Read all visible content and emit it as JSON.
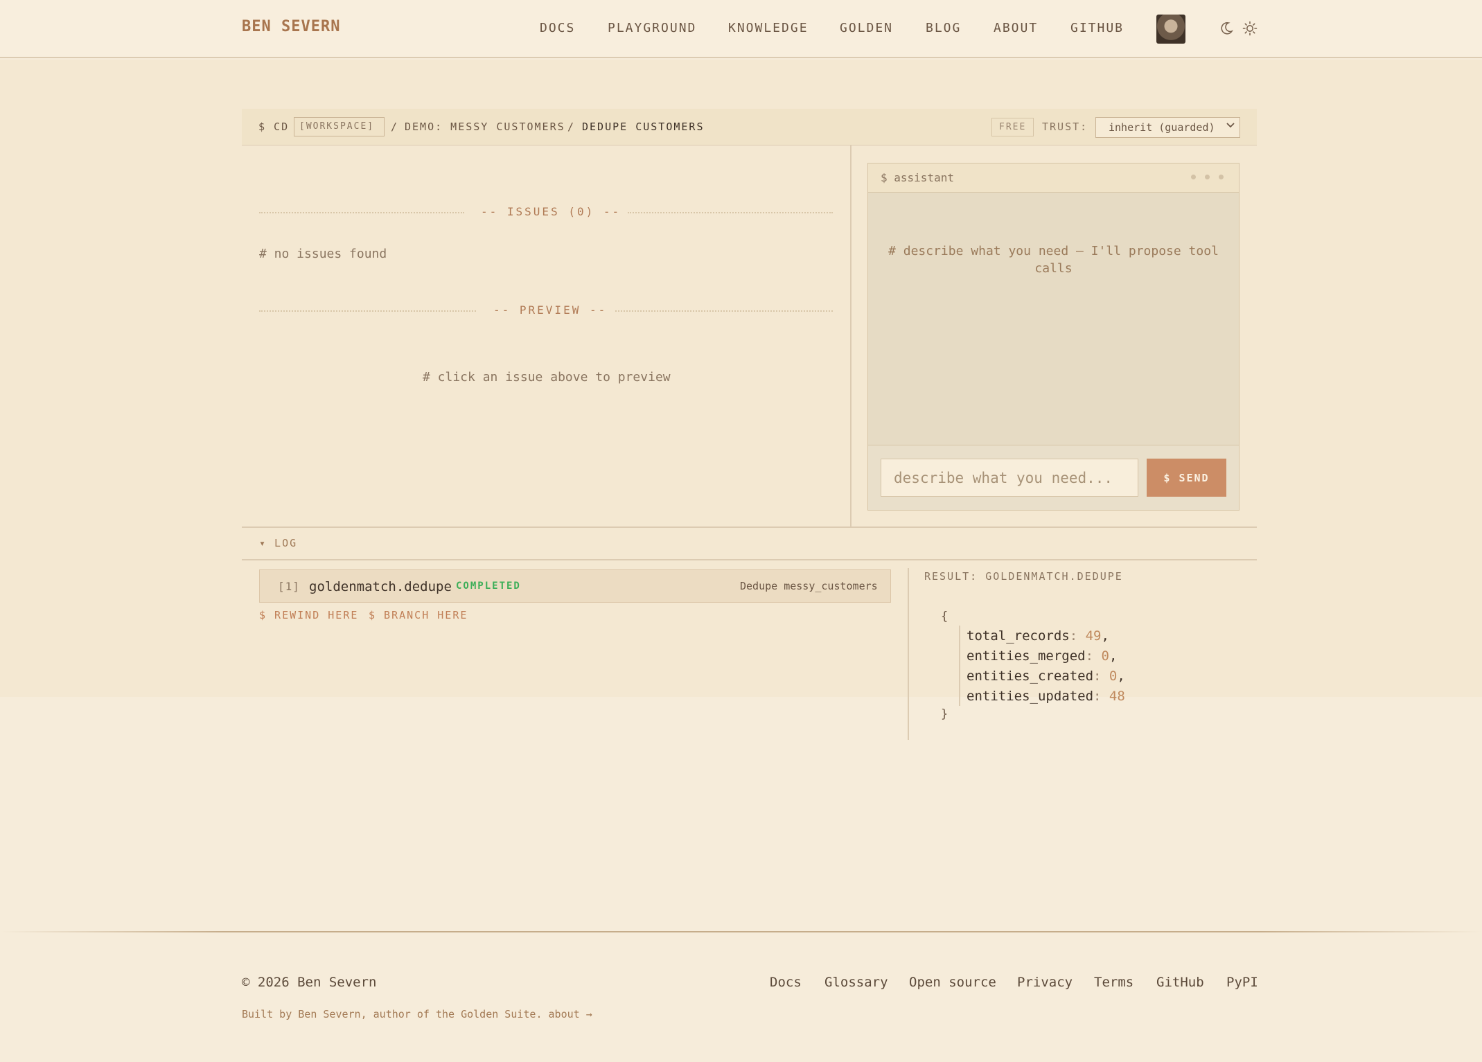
{
  "header": {
    "brand": "BEN SEVERN",
    "nav": [
      "DOCS",
      "PLAYGROUND",
      "KNOWLEDGE",
      "GOLDEN",
      "BLOG",
      "ABOUT",
      "GITHUB"
    ],
    "icons": [
      "avatar",
      "moon-icon",
      "sun-icon"
    ]
  },
  "breadcrumb": {
    "prompt": "$ CD",
    "workspace": "[WORKSPACE]",
    "sep1": "/",
    "demo": "DEMO: MESSY CUSTOMERS",
    "sep2": "/",
    "current": "DEDUPE CUSTOMERS",
    "plan_badge": "FREE",
    "trust_label": "TRUST:",
    "trust_value": "inherit (guarded)"
  },
  "issues": {
    "title": "-- ISSUES (0) --",
    "empty_text": "# no issues found"
  },
  "preview": {
    "title": "-- PREVIEW --",
    "empty_text": "# click an issue above to preview"
  },
  "assistant": {
    "title": "$ assistant",
    "message_line1": "# describe what you need — I'll propose tool",
    "message_line2": "calls",
    "input_placeholder": "describe what you need...",
    "send_label": "$ SEND"
  },
  "log": {
    "title": "▾ LOG",
    "entries": [
      {
        "index": "[1]",
        "tool": "goldenmatch.dedupe",
        "status": "COMPLETED",
        "description": "Dedupe messy_customers"
      }
    ],
    "actions": {
      "rewind": "$ REWIND HERE",
      "branch": "$ BRANCH HERE"
    }
  },
  "result": {
    "title": "RESULT: GOLDENMATCH.DEDUPE",
    "open_brace": "{",
    "close_brace": "}",
    "fields": [
      {
        "key": "total_records",
        "value": "49",
        "sep": ","
      },
      {
        "key": "entities_merged",
        "value": "0",
        "sep": ","
      },
      {
        "key": "entities_created",
        "value": "0",
        "sep": ","
      },
      {
        "key": "entities_updated",
        "value": "48",
        "sep": ""
      }
    ]
  },
  "footer": {
    "copyright": "© 2026 Ben Severn",
    "built_by": "Built by Ben Severn, author of the Golden Suite. about →",
    "links": [
      "Docs",
      "Glossary",
      "Open source",
      "Privacy",
      "Terms",
      "GitHub",
      "PyPI"
    ]
  },
  "colors": {
    "background": "#f6ecda",
    "accent": "#cc8d66",
    "brand": "#a8754e",
    "success": "#3cae58"
  }
}
